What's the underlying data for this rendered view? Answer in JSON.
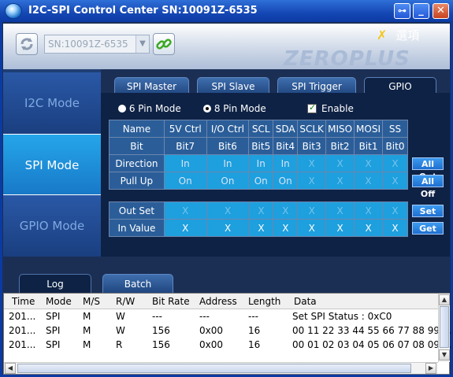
{
  "window": {
    "title": "I2C-SPI Control Center SN:10091Z-6535"
  },
  "toolbar": {
    "serial_value": "SN:10091Z-6535",
    "settings_label": "選項",
    "brand": "ZEROPLUS"
  },
  "nav": [
    {
      "label": "I2C Mode"
    },
    {
      "label": "SPI Mode"
    },
    {
      "label": "GPIO Mode"
    }
  ],
  "tabs": [
    {
      "label": "SPI Master"
    },
    {
      "label": "SPI Slave"
    },
    {
      "label": "SPI Trigger"
    },
    {
      "label": "GPIO"
    }
  ],
  "gpio": {
    "pin6_label": "6 Pin Mode",
    "pin8_label": "8 Pin Mode",
    "enable_label": "Enable",
    "selected_mode": "8 Pin Mode",
    "enabled": true,
    "grid": {
      "row_labels": [
        "Name",
        "Bit",
        "Direction",
        "Pull Up"
      ],
      "names": [
        "5V Ctrl",
        "I/O Ctrl",
        "SCL",
        "SDA",
        "SCLK",
        "MISO",
        "MOSI",
        "SS"
      ],
      "bits": [
        "Bit7",
        "Bit6",
        "Bit5",
        "Bit4",
        "Bit3",
        "Bit2",
        "Bit1",
        "Bit0"
      ],
      "direction": [
        "In",
        "In",
        "In",
        "In",
        "X",
        "X",
        "X",
        "X"
      ],
      "pullup": [
        "On",
        "On",
        "On",
        "On",
        "X",
        "X",
        "X",
        "X"
      ]
    },
    "io": {
      "row_labels": [
        "Out Set",
        "In Value"
      ],
      "out_set": [
        "X",
        "X",
        "X",
        "X",
        "X",
        "X",
        "X",
        "X"
      ],
      "in_value": [
        "X",
        "X",
        "X",
        "X",
        "X",
        "X",
        "X",
        "X"
      ]
    },
    "buttons": {
      "all_out": "All Out",
      "all_off": "All Off",
      "set": "Set",
      "get": "Get"
    }
  },
  "bottom_tabs": [
    {
      "label": "Log"
    },
    {
      "label": "Batch"
    }
  ],
  "log": {
    "columns": [
      "Time",
      "Mode",
      "M/S",
      "R/W",
      "Bit Rate",
      "Address",
      "Length",
      "Data"
    ],
    "rows": [
      [
        "201...",
        "SPI",
        "M",
        "W",
        "---",
        "---",
        "---",
        "Set SPI Status : 0xC0"
      ],
      [
        "201...",
        "SPI",
        "M",
        "W",
        "156",
        "0x00",
        "16",
        "00 11 22 33 44 55 66 77 88 99 ..."
      ],
      [
        "201...",
        "SPI",
        "M",
        "R",
        "156",
        "0x00",
        "16",
        "00 01 02 03 04 05 06 07 08 09 ..."
      ]
    ]
  },
  "colors": {
    "accent": "#1e9fde",
    "titlebar": "#1547b4",
    "panel": "#0e2245"
  }
}
